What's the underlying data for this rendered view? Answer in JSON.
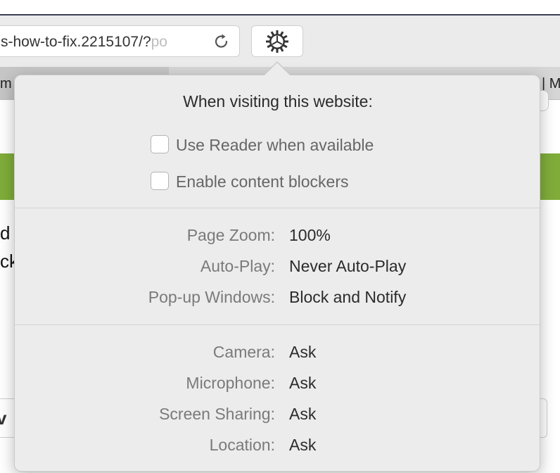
{
  "toolbar": {
    "url_visible": "s-how-to-fix.2215107/?",
    "url_faded": "po"
  },
  "tabs": {
    "left_fragment": "m",
    "right_fragment": "| M"
  },
  "page_behind": {
    "line1": "d",
    "line2": "ck",
    "box_text": "v"
  },
  "popover": {
    "title": "When visiting this website:",
    "checkboxes": [
      {
        "label": "Use Reader when available",
        "checked": false
      },
      {
        "label": "Enable content blockers",
        "checked": false
      }
    ],
    "settings": [
      {
        "key": "Page Zoom:",
        "value": "100%"
      },
      {
        "key": "Auto-Play:",
        "value": "Never Auto-Play"
      },
      {
        "key": "Pop-up Windows:",
        "value": "Block and Notify"
      }
    ],
    "permissions": [
      {
        "key": "Camera:",
        "value": "Ask"
      },
      {
        "key": "Microphone:",
        "value": "Ask"
      },
      {
        "key": "Screen Sharing:",
        "value": "Ask"
      },
      {
        "key": "Location:",
        "value": "Ask"
      }
    ]
  },
  "colors": {
    "accent_green": "#80ad3a",
    "popover_bg": "#ececec"
  }
}
